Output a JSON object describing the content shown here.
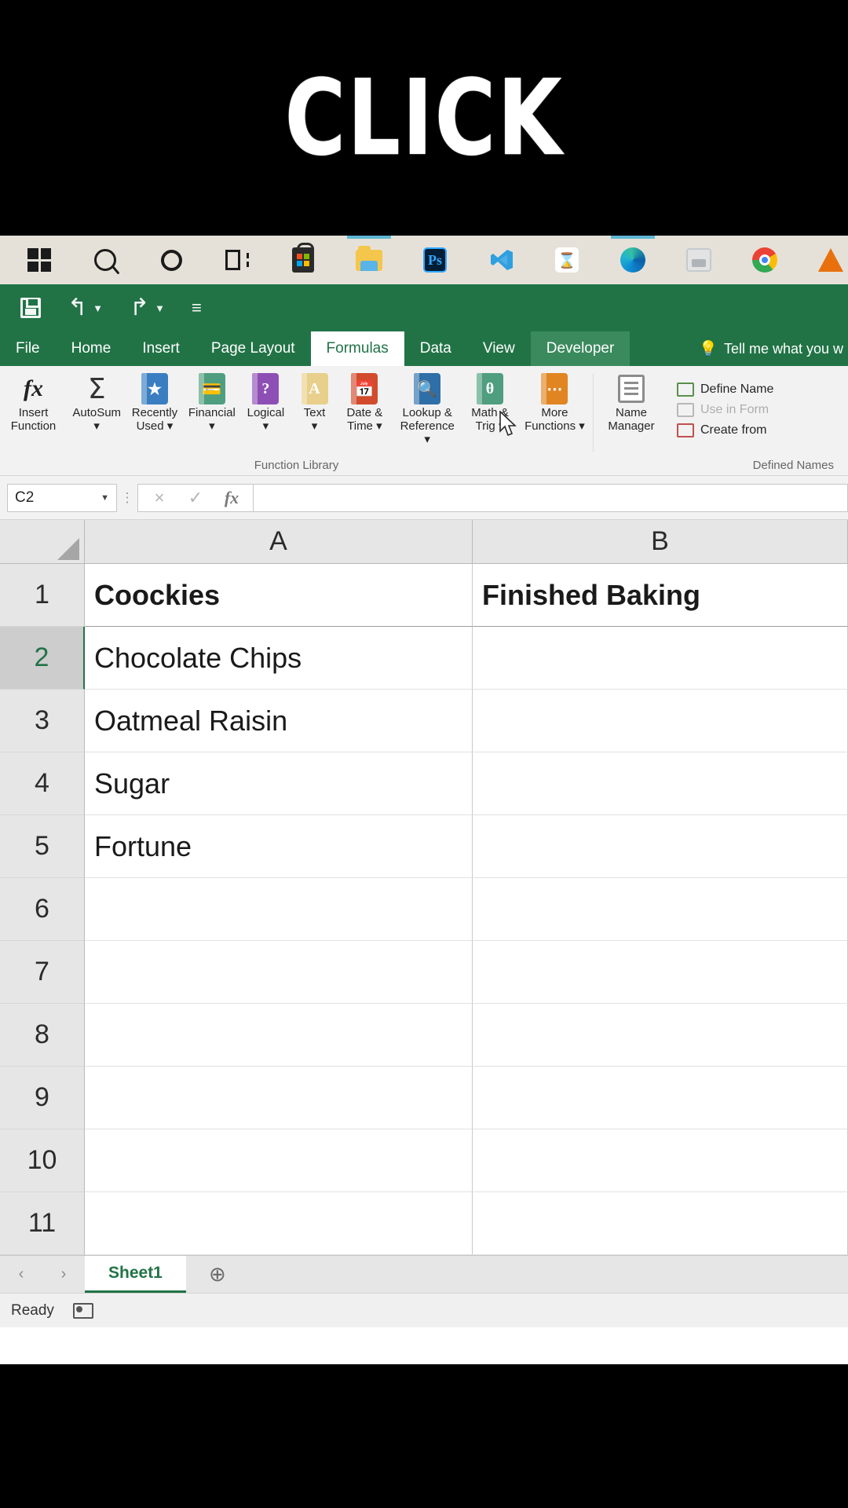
{
  "overlay": {
    "click_text": "CLICK"
  },
  "taskbar": {
    "items": [
      {
        "name": "start-button",
        "icon": "windows-logo-icon"
      },
      {
        "name": "search-button",
        "icon": "search-icon"
      },
      {
        "name": "cortana-button",
        "icon": "cortana-circle-icon"
      },
      {
        "name": "task-view-button",
        "icon": "task-view-icon"
      },
      {
        "name": "microsoft-store-button",
        "icon": "microsoft-store-icon"
      },
      {
        "name": "file-explorer-button",
        "icon": "folder-icon"
      },
      {
        "name": "photoshop-button",
        "icon": "photoshop-icon",
        "label": "Ps"
      },
      {
        "name": "vs-code-button",
        "icon": "vs-code-icon"
      },
      {
        "name": "hourglass-app-button",
        "icon": "hourglass-icon"
      },
      {
        "name": "microsoft-edge-button",
        "icon": "edge-icon"
      },
      {
        "name": "paint-button",
        "icon": "paint-icon"
      },
      {
        "name": "google-chrome-button",
        "icon": "chrome-icon"
      },
      {
        "name": "vlc-button",
        "icon": "vlc-cone-icon"
      },
      {
        "name": "overflow-app-button",
        "icon": "app-icon"
      }
    ]
  },
  "quick_access": {
    "save_label": "Save",
    "undo_label": "Undo",
    "redo_label": "Redo",
    "customize_label": "Customize Quick Access Toolbar"
  },
  "ribbon": {
    "tabs": [
      {
        "label": "File",
        "state": "normal"
      },
      {
        "label": "Home",
        "state": "normal"
      },
      {
        "label": "Insert",
        "state": "normal"
      },
      {
        "label": "Page Layout",
        "state": "normal"
      },
      {
        "label": "Formulas",
        "state": "selected"
      },
      {
        "label": "Data",
        "state": "normal"
      },
      {
        "label": "View",
        "state": "normal"
      },
      {
        "label": "Developer",
        "state": "hovered"
      }
    ],
    "tell_me": "Tell me what you w",
    "groups": [
      {
        "name": "Function Library",
        "commands": [
          {
            "label": "Insert\nFunction",
            "icon": "fx-icon"
          },
          {
            "label": "AutoSum\n▾",
            "icon": "sigma-icon"
          },
          {
            "label": "Recently\nUsed ▾",
            "icon": "recently-used-book-icon"
          },
          {
            "label": "Financial\n▾",
            "icon": "financial-book-icon"
          },
          {
            "label": "Logical\n▾",
            "icon": "logical-book-icon"
          },
          {
            "label": "Text\n▾",
            "icon": "text-book-icon"
          },
          {
            "label": "Date &\nTime ▾",
            "icon": "date-time-book-icon"
          },
          {
            "label": "Lookup &\nReference ▾",
            "icon": "lookup-reference-book-icon"
          },
          {
            "label": "Math &\nTrig ▾",
            "icon": "math-trig-book-icon"
          },
          {
            "label": "More\nFunctions ▾",
            "icon": "more-functions-book-icon"
          }
        ]
      },
      {
        "name": "Defined Names",
        "commands": [
          {
            "label": "Name\nManager",
            "icon": "name-manager-icon"
          }
        ],
        "items": [
          {
            "label": "Define Name",
            "icon": "define-name-icon",
            "disabled": false
          },
          {
            "label": "Use in Form",
            "icon": "use-in-formula-icon",
            "disabled": true
          },
          {
            "label": "Create from",
            "icon": "create-from-selection-icon",
            "disabled": false
          }
        ]
      }
    ]
  },
  "formula_bar": {
    "name_box_value": "C2",
    "cancel_label": "Cancel",
    "enter_label": "Enter",
    "insert_function_label": "Insert Function",
    "formula_value": ""
  },
  "sheet": {
    "columns": [
      "A",
      "B"
    ],
    "row_numbers": [
      "1",
      "2",
      "3",
      "4",
      "5",
      "6",
      "7",
      "8",
      "9",
      "10",
      "11"
    ],
    "selected_row": "2",
    "rows": [
      {
        "r": "1",
        "a": "Coockies",
        "b": "Finished Baking",
        "bold": true
      },
      {
        "r": "2",
        "a": "Chocolate Chips",
        "b": "",
        "bold": false
      },
      {
        "r": "3",
        "a": "Oatmeal Raisin",
        "b": "",
        "bold": false
      },
      {
        "r": "4",
        "a": "Sugar",
        "b": "",
        "bold": false
      },
      {
        "r": "5",
        "a": "Fortune",
        "b": "",
        "bold": false
      },
      {
        "r": "6",
        "a": "",
        "b": "",
        "bold": false
      },
      {
        "r": "7",
        "a": "",
        "b": "",
        "bold": false
      },
      {
        "r": "8",
        "a": "",
        "b": "",
        "bold": false
      },
      {
        "r": "9",
        "a": "",
        "b": "",
        "bold": false
      },
      {
        "r": "10",
        "a": "",
        "b": "",
        "bold": false
      },
      {
        "r": "11",
        "a": "",
        "b": "",
        "bold": false
      }
    ]
  },
  "sheet_bar": {
    "prev_label": "‹",
    "next_label": "›",
    "tabs": [
      "Sheet1"
    ],
    "active_tab": "Sheet1",
    "add_sheet_label": "＋"
  },
  "status_bar": {
    "state": "Ready",
    "macro_label": "Record Macro"
  },
  "colors": {
    "excel_green": "#217346",
    "tab_hover_green": "#3a8a5d",
    "taskbar": "#e6e1d8",
    "ribbon_bg": "#f2f2f2",
    "header_gray": "#e6e6e6",
    "selected_header": "#cdcdcd"
  }
}
